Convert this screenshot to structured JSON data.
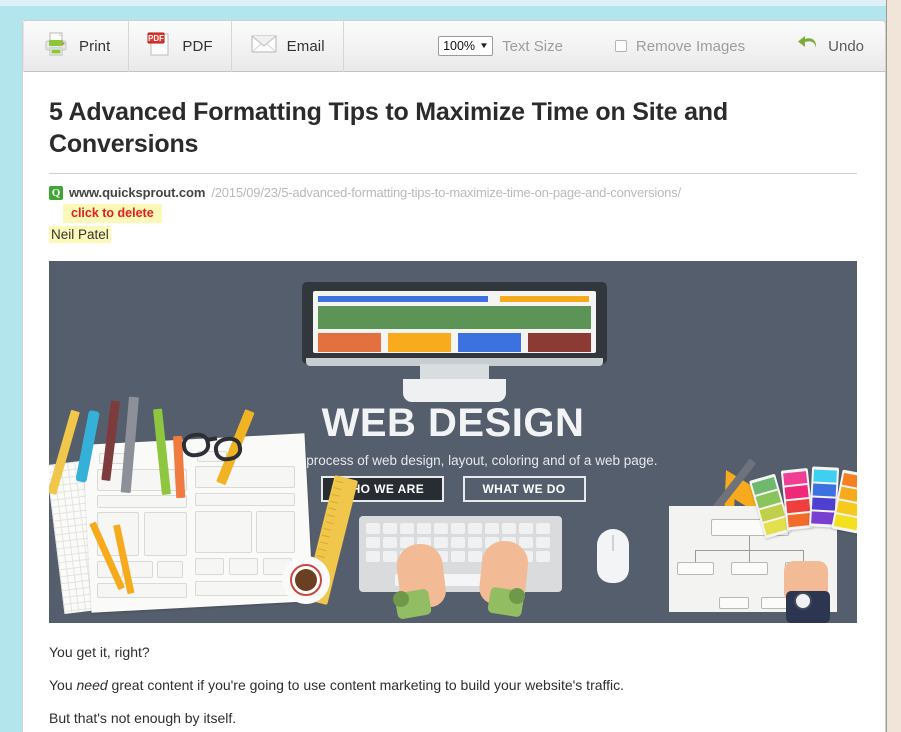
{
  "toolbar": {
    "print_label": "Print",
    "pdf_label": "PDF",
    "email_label": "Email",
    "text_size_value": "100%",
    "text_size_caret": "▼",
    "text_size_label": "Text Size",
    "remove_images_label": "Remove Images",
    "remove_images_checked": false,
    "undo_label": "Undo"
  },
  "article": {
    "title": "5 Advanced Formatting Tips to Maximize Time on Site and Conversions",
    "favicon_letter": "Q",
    "url_domain": "www.quicksprout.com",
    "url_path": "/2015/09/23/5-advanced-formatting-tips-to-maximize-time-on-page-and-conversions/",
    "delete_hint": "click to delete",
    "byline": "Neil Patel",
    "paragraphs": [
      "You get it, right?",
      "But that's not enough by itself."
    ],
    "p2_before": "You ",
    "p2_italic": "need",
    "p2_after": " great content if you're going to use content marketing to build your website's traffic."
  },
  "hero": {
    "heading": "WEB DESIGN",
    "subheading": "Flat style process of web design, layout, coloring and of a web page.",
    "button_primary": "WHO WE ARE",
    "button_secondary": "WHAT WE DO"
  },
  "colors": {
    "page_background": "#b3e6ec",
    "right_gutter": "#f1e4d9",
    "hero_background": "#555e6d",
    "favicon_green": "#3fa535",
    "highlight_yellow": "#fcf8b8",
    "delete_red": "#e02020",
    "undo_green": "#7cad3a",
    "pdf_red": "#e8332a"
  }
}
